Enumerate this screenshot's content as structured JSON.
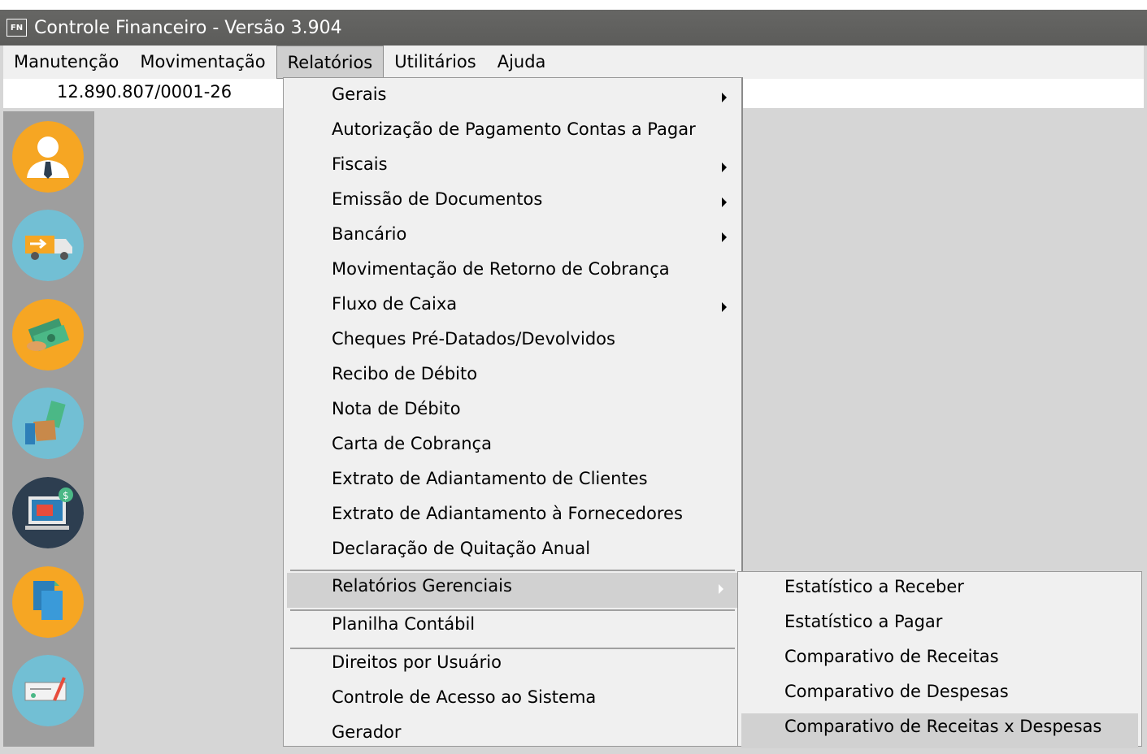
{
  "window": {
    "icon_label": "FN",
    "title": "Controle Financeiro - Versão 3.904"
  },
  "menubar": [
    {
      "label": "Manutenção"
    },
    {
      "label": "Movimentação"
    },
    {
      "label": "Relatórios"
    },
    {
      "label": "Utilitários"
    },
    {
      "label": "Ajuda"
    }
  ],
  "cnpj": "12.890.807/0001-26",
  "sidebar": [
    {
      "icon": "user-icon"
    },
    {
      "icon": "delivery-truck-icon"
    },
    {
      "icon": "money-icon"
    },
    {
      "icon": "payment-hand-icon"
    },
    {
      "icon": "computer-billing-icon"
    },
    {
      "icon": "documents-icon"
    },
    {
      "icon": "check-icon"
    }
  ],
  "relatorios_menu": [
    {
      "label": "Gerais",
      "submenu": true
    },
    {
      "label": "Autorização de Pagamento Contas a Pagar",
      "submenu": false
    },
    {
      "label": "Fiscais",
      "submenu": true
    },
    {
      "label": "Emissão de Documentos",
      "submenu": true
    },
    {
      "label": "Bancário",
      "submenu": true
    },
    {
      "label": "Movimentação de Retorno de Cobrança",
      "submenu": false
    },
    {
      "label": "Fluxo de Caixa",
      "submenu": true
    },
    {
      "label": "Cheques Pré-Datados/Devolvidos",
      "submenu": false
    },
    {
      "label": "Recibo de Débito",
      "submenu": false
    },
    {
      "label": "Nota de Débito",
      "submenu": false
    },
    {
      "label": "Carta de Cobrança",
      "submenu": false
    },
    {
      "label": "Extrato de Adiantamento de Clientes",
      "submenu": false
    },
    {
      "label": "Extrato de Adiantamento à Fornecedores",
      "submenu": false
    },
    {
      "label": "Declaração de Quitação Anual",
      "submenu": false
    },
    {
      "label": "Relatórios Gerenciais",
      "submenu": true,
      "highlighted": true
    },
    {
      "label": "Planilha Contábil",
      "submenu": false
    },
    {
      "label": "Direitos por Usuário",
      "submenu": false
    },
    {
      "label": "Controle de Acesso ao Sistema",
      "submenu": false
    },
    {
      "label": "Gerador",
      "submenu": false
    }
  ],
  "gerenciais_submenu": [
    {
      "label": "Estatístico a Receber"
    },
    {
      "label": "Estatístico a Pagar"
    },
    {
      "label": "Comparativo de Receitas"
    },
    {
      "label": "Comparativo de Despesas"
    },
    {
      "label": "Comparativo de Receitas x Despesas",
      "highlighted": true
    }
  ]
}
